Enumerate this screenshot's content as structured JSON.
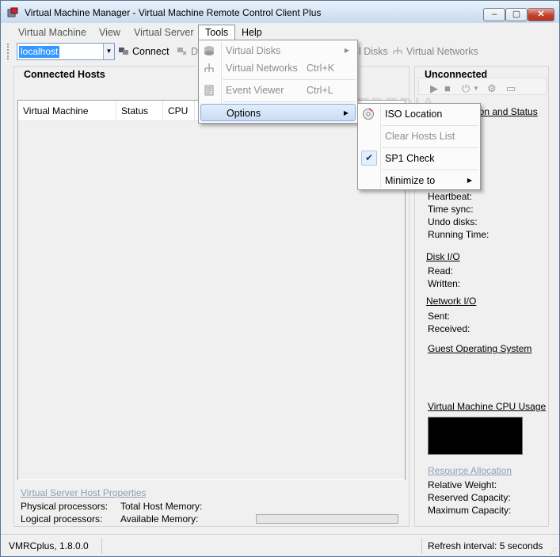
{
  "window": {
    "title": "Virtual Machine Manager - Virtual Machine Remote Control Client Plus",
    "minimize": "–",
    "maximize": "▢",
    "close": "✕"
  },
  "menubar": {
    "items": [
      "Virtual Machine",
      "View",
      "Virtual Server",
      "Tools",
      "Help"
    ]
  },
  "toolbar": {
    "host_value": "localhost",
    "connect_label": "Connect",
    "disconnect_label": "D",
    "virtual_disks_label": "l Disks",
    "virtual_networks_label": "Virtual Networks"
  },
  "tools_menu": {
    "items": [
      {
        "label": "Virtual Disks",
        "shortcut": "",
        "has_submenu": true
      },
      {
        "label": "Virtual Networks",
        "shortcut": "Ctrl+K",
        "has_submenu": false
      },
      {
        "label": "Event Viewer",
        "shortcut": "Ctrl+L",
        "has_submenu": false
      },
      {
        "label": "Options",
        "shortcut": "",
        "has_submenu": true
      }
    ]
  },
  "options_menu": {
    "items": [
      {
        "label": "ISO Location",
        "enabled": true
      },
      {
        "label": "Clear Hosts List",
        "enabled": false
      },
      {
        "label": "SP1 Check",
        "enabled": true,
        "checked": true
      },
      {
        "label": "Minimize to",
        "enabled": true,
        "has_submenu": true
      }
    ]
  },
  "left_panel": {
    "title": "Connected Hosts",
    "columns": [
      "Virtual Machine Name",
      "Status",
      "CPU"
    ],
    "host_properties_link": "Virtual Server Host Properties",
    "physical_processors": "Physical processors:",
    "logical_processors": "Logical processors:",
    "total_host_memory": "Total Host Memory:",
    "available_memory": "Available Memory:",
    "memory_progress": 0
  },
  "right_panel": {
    "title": "Unconnected",
    "config_link": "ion and Status",
    "heartbeat": "Heartbeat:",
    "time_sync": "Time sync:",
    "undo_disks": "Undo disks:",
    "running_time": "Running Time:",
    "disk_io": "Disk I/O",
    "read": "Read:",
    "written": "Written:",
    "network_io": "Network I/O",
    "sent": "Sent:",
    "received": "Received:",
    "guest_os": "Guest Operating System",
    "cpu_usage": "Virtual Machine CPU Usage",
    "resource_allocation": "Resource Allocation",
    "relative_weight": "Relative Weight:",
    "reserved_capacity": "Reserved Capacity:",
    "maximum_capacity": "Maximum Capacity:"
  },
  "statusbar": {
    "version": "VMRCplus, 1.8.0.0",
    "refresh": "Refresh interval: 5 seconds"
  },
  "watermark": "SOFTPEDIA"
}
